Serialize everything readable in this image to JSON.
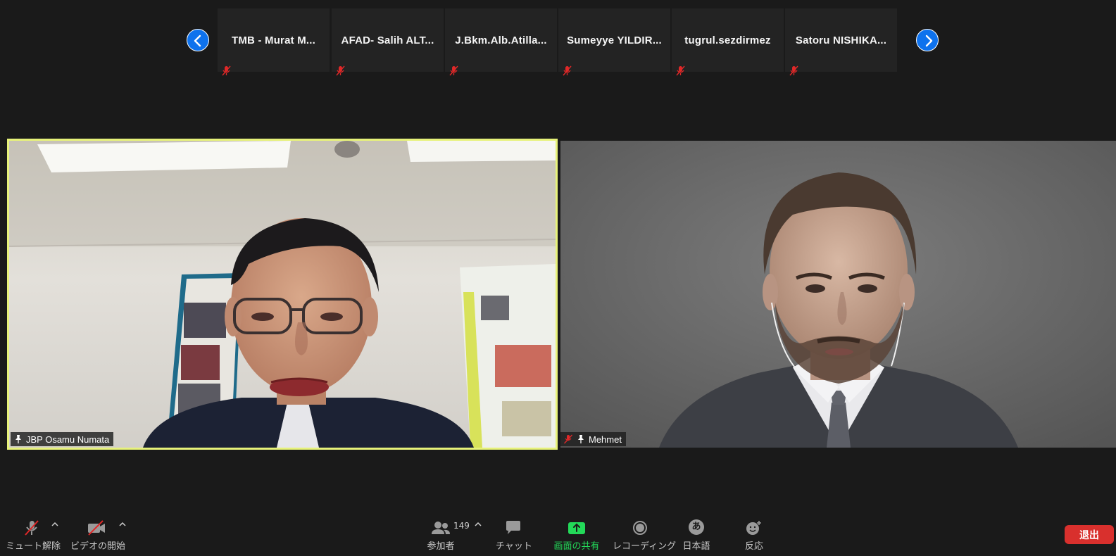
{
  "gallery": {
    "participants": [
      {
        "name": "TMB - Murat M..."
      },
      {
        "name": "AFAD- Salih ALT..."
      },
      {
        "name": "J.Bkm.Alb.Atilla..."
      },
      {
        "name": "Sumeyye YILDIR..."
      },
      {
        "name": "tugrul.sezdirmez"
      },
      {
        "name": "Satoru NISHIKA..."
      }
    ]
  },
  "speakers": {
    "left": {
      "name": "JBP Osamu Numata"
    },
    "right": {
      "name": "Mehmet"
    }
  },
  "toolbar": {
    "mute_label": "ミュート解除",
    "video_label": "ビデオの開始",
    "participants_label": "参加者",
    "participants_count": "149",
    "chat_label": "チャット",
    "share_label": "画面の共有",
    "record_label": "レコーディング",
    "language_label": "日本語",
    "language_glyph": "あ",
    "reactions_label": "反応",
    "leave_label": "退出"
  },
  "colors": {
    "accent_blue": "#0e72ed",
    "share_green": "#23d959",
    "leave_red": "#d9302d",
    "active_speaker_border": "#e7f27a",
    "mute_red": "#e02828"
  }
}
